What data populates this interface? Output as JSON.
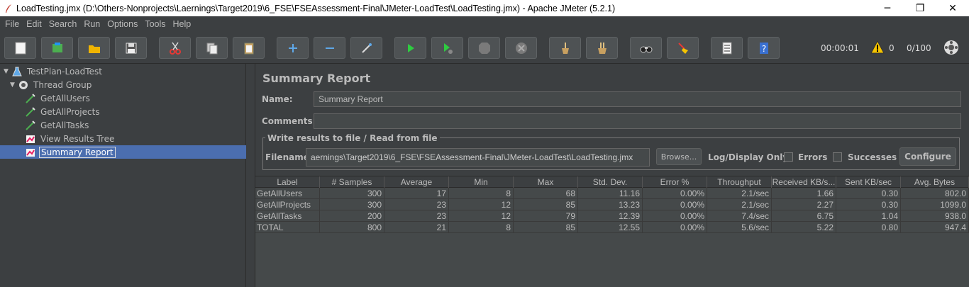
{
  "window": {
    "title": "LoadTesting.jmx (D:\\Others-Nonprojects\\Laernings\\Target2019\\6_FSE\\FSEAssessment-Final\\JMeter-LoadTest\\LoadTesting.jmx) - Apache JMeter (5.2.1)",
    "minimize": "─",
    "restore": "❐",
    "close": "✕"
  },
  "menu": [
    "File",
    "Edit",
    "Search",
    "Run",
    "Options",
    "Tools",
    "Help"
  ],
  "status": {
    "timer": "00:00:01",
    "warnings": "0",
    "threads": "0/100"
  },
  "tree": {
    "items": [
      {
        "label": "TestPlan-LoadTest"
      },
      {
        "label": "Thread Group"
      },
      {
        "label": "GetAllUsers"
      },
      {
        "label": "GetAllProjects"
      },
      {
        "label": "GetAllTasks"
      },
      {
        "label": "View Results Tree"
      },
      {
        "label": "Summary Report"
      }
    ]
  },
  "panel": {
    "title": "Summary Report",
    "name_label": "Name:",
    "name_value": "Summary Report",
    "comments_label": "Comments:",
    "comments_value": "",
    "file_group_title": "Write results to file / Read from file",
    "filename_label": "Filename",
    "filename_value": "aernings\\Target2019\\6_FSE\\FSEAssessment-Final\\JMeter-LoadTest\\LoadTesting.jmx",
    "browse_label": "Browse...",
    "log_display_label": "Log/Display Only:",
    "errors_label": "Errors",
    "successes_label": "Successes",
    "configure_label": "Configure"
  },
  "table": {
    "columns": [
      "Label",
      "# Samples",
      "Average",
      "Min",
      "Max",
      "Std. Dev.",
      "Error %",
      "Throughput",
      "Received KB/s...",
      "Sent KB/sec",
      "Avg. Bytes"
    ],
    "rows": [
      [
        "GetAllUsers",
        "300",
        "17",
        "8",
        "68",
        "11.16",
        "0.00%",
        "2.1/sec",
        "1.66",
        "0.30",
        "802.0"
      ],
      [
        "GetAllProjects",
        "300",
        "23",
        "12",
        "85",
        "13.23",
        "0.00%",
        "2.1/sec",
        "2.27",
        "0.30",
        "1099.0"
      ],
      [
        "GetAllTasks",
        "200",
        "23",
        "12",
        "79",
        "12.39",
        "0.00%",
        "7.4/sec",
        "6.75",
        "1.04",
        "938.0"
      ],
      [
        "TOTAL",
        "800",
        "21",
        "8",
        "85",
        "12.55",
        "0.00%",
        "5.6/sec",
        "5.22",
        "0.80",
        "947.4"
      ]
    ]
  },
  "colors": {
    "background": "#3c3f41",
    "selection": "#4b6eaf",
    "field": "#45494a",
    "text": "#bbbbbb"
  }
}
